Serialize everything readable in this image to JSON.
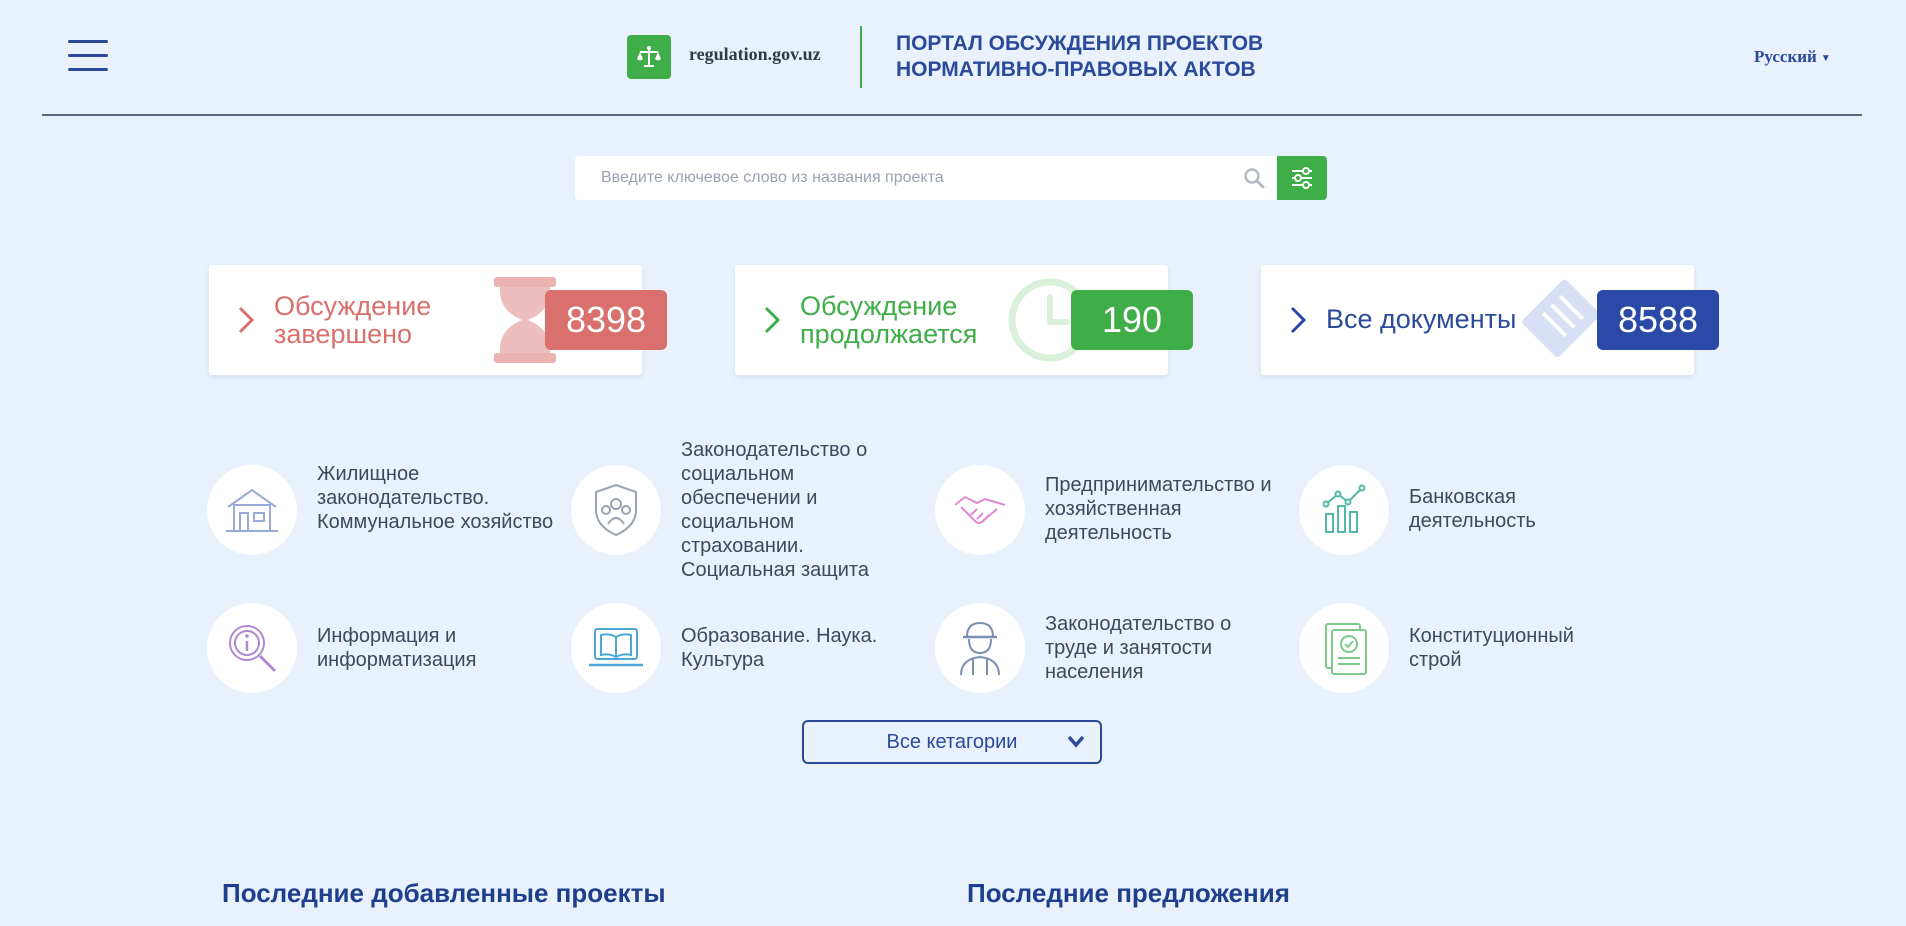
{
  "header": {
    "site_domain": "regulation.gov.uz",
    "portal_title_line1": "ПОРТАЛ ОБСУЖДЕНИЯ ПРОЕКТОВ",
    "portal_title_line2": "НОРМАТИВНО-ПРАВОВЫХ АКТОВ",
    "language": "Русский"
  },
  "search": {
    "placeholder": "Введите ключевое слово из названия проекта"
  },
  "stats": [
    {
      "line1": "Обсуждение",
      "line2": "завершено",
      "count": "8398",
      "color": "#d9706d"
    },
    {
      "line1": "Обсуждение",
      "line2": "продолжается",
      "count": "190",
      "color": "#3fae49"
    },
    {
      "line1": "Все документы",
      "count": "8588",
      "color": "#2b4aa8"
    }
  ],
  "categories": [
    {
      "name": "Жилищное законодательство. Коммунальное хозяйство",
      "icon": "house-icon"
    },
    {
      "name": "Законодательство о социальном обеспечении и социальном страховании. Социальная защита",
      "icon": "shield-people-icon"
    },
    {
      "name": "Предпринимательство и хозяйственная деятельность",
      "icon": "handshake-icon"
    },
    {
      "name": "Банковская деятельность",
      "icon": "bar-chart-icon"
    },
    {
      "name": "Информация и информатизация",
      "icon": "info-magnifier-icon"
    },
    {
      "name": "Образование. Наука. Культура",
      "icon": "laptop-book-icon"
    },
    {
      "name": "Законодательство о труде и занятости населения",
      "icon": "worker-icon"
    },
    {
      "name": "Конституционный строй",
      "icon": "document-check-icon"
    }
  ],
  "all_categories_label": "Все кетагории",
  "sections": {
    "latest_projects": "Последние добавленные проекты",
    "latest_proposals": "Последние предложения"
  }
}
